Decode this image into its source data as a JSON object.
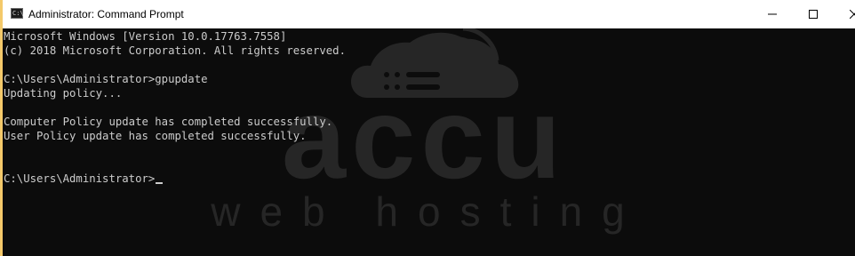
{
  "window": {
    "title": "Administrator: Command Prompt",
    "icon": "cmd-icon",
    "icon_glyph": "C:\\",
    "controls": [
      "minimize-icon",
      "maximize-icon",
      "close-icon"
    ]
  },
  "console": {
    "background": "#0c0c0c",
    "foreground": "#cccccc",
    "lines": [
      "Microsoft Windows [Version 10.0.17763.7558]",
      "(c) 2018 Microsoft Corporation. All rights reserved.",
      "",
      "C:\\Users\\Administrator>gpupdate",
      "Updating policy...",
      "",
      "Computer Policy update has completed successfully.",
      "User Policy update has completed successfully.",
      "",
      "",
      "C:\\Users\\Administrator>"
    ]
  },
  "watermark": {
    "logo": "cloud-wifi-logo",
    "brand": "accu",
    "tagline": "web hosting"
  }
}
